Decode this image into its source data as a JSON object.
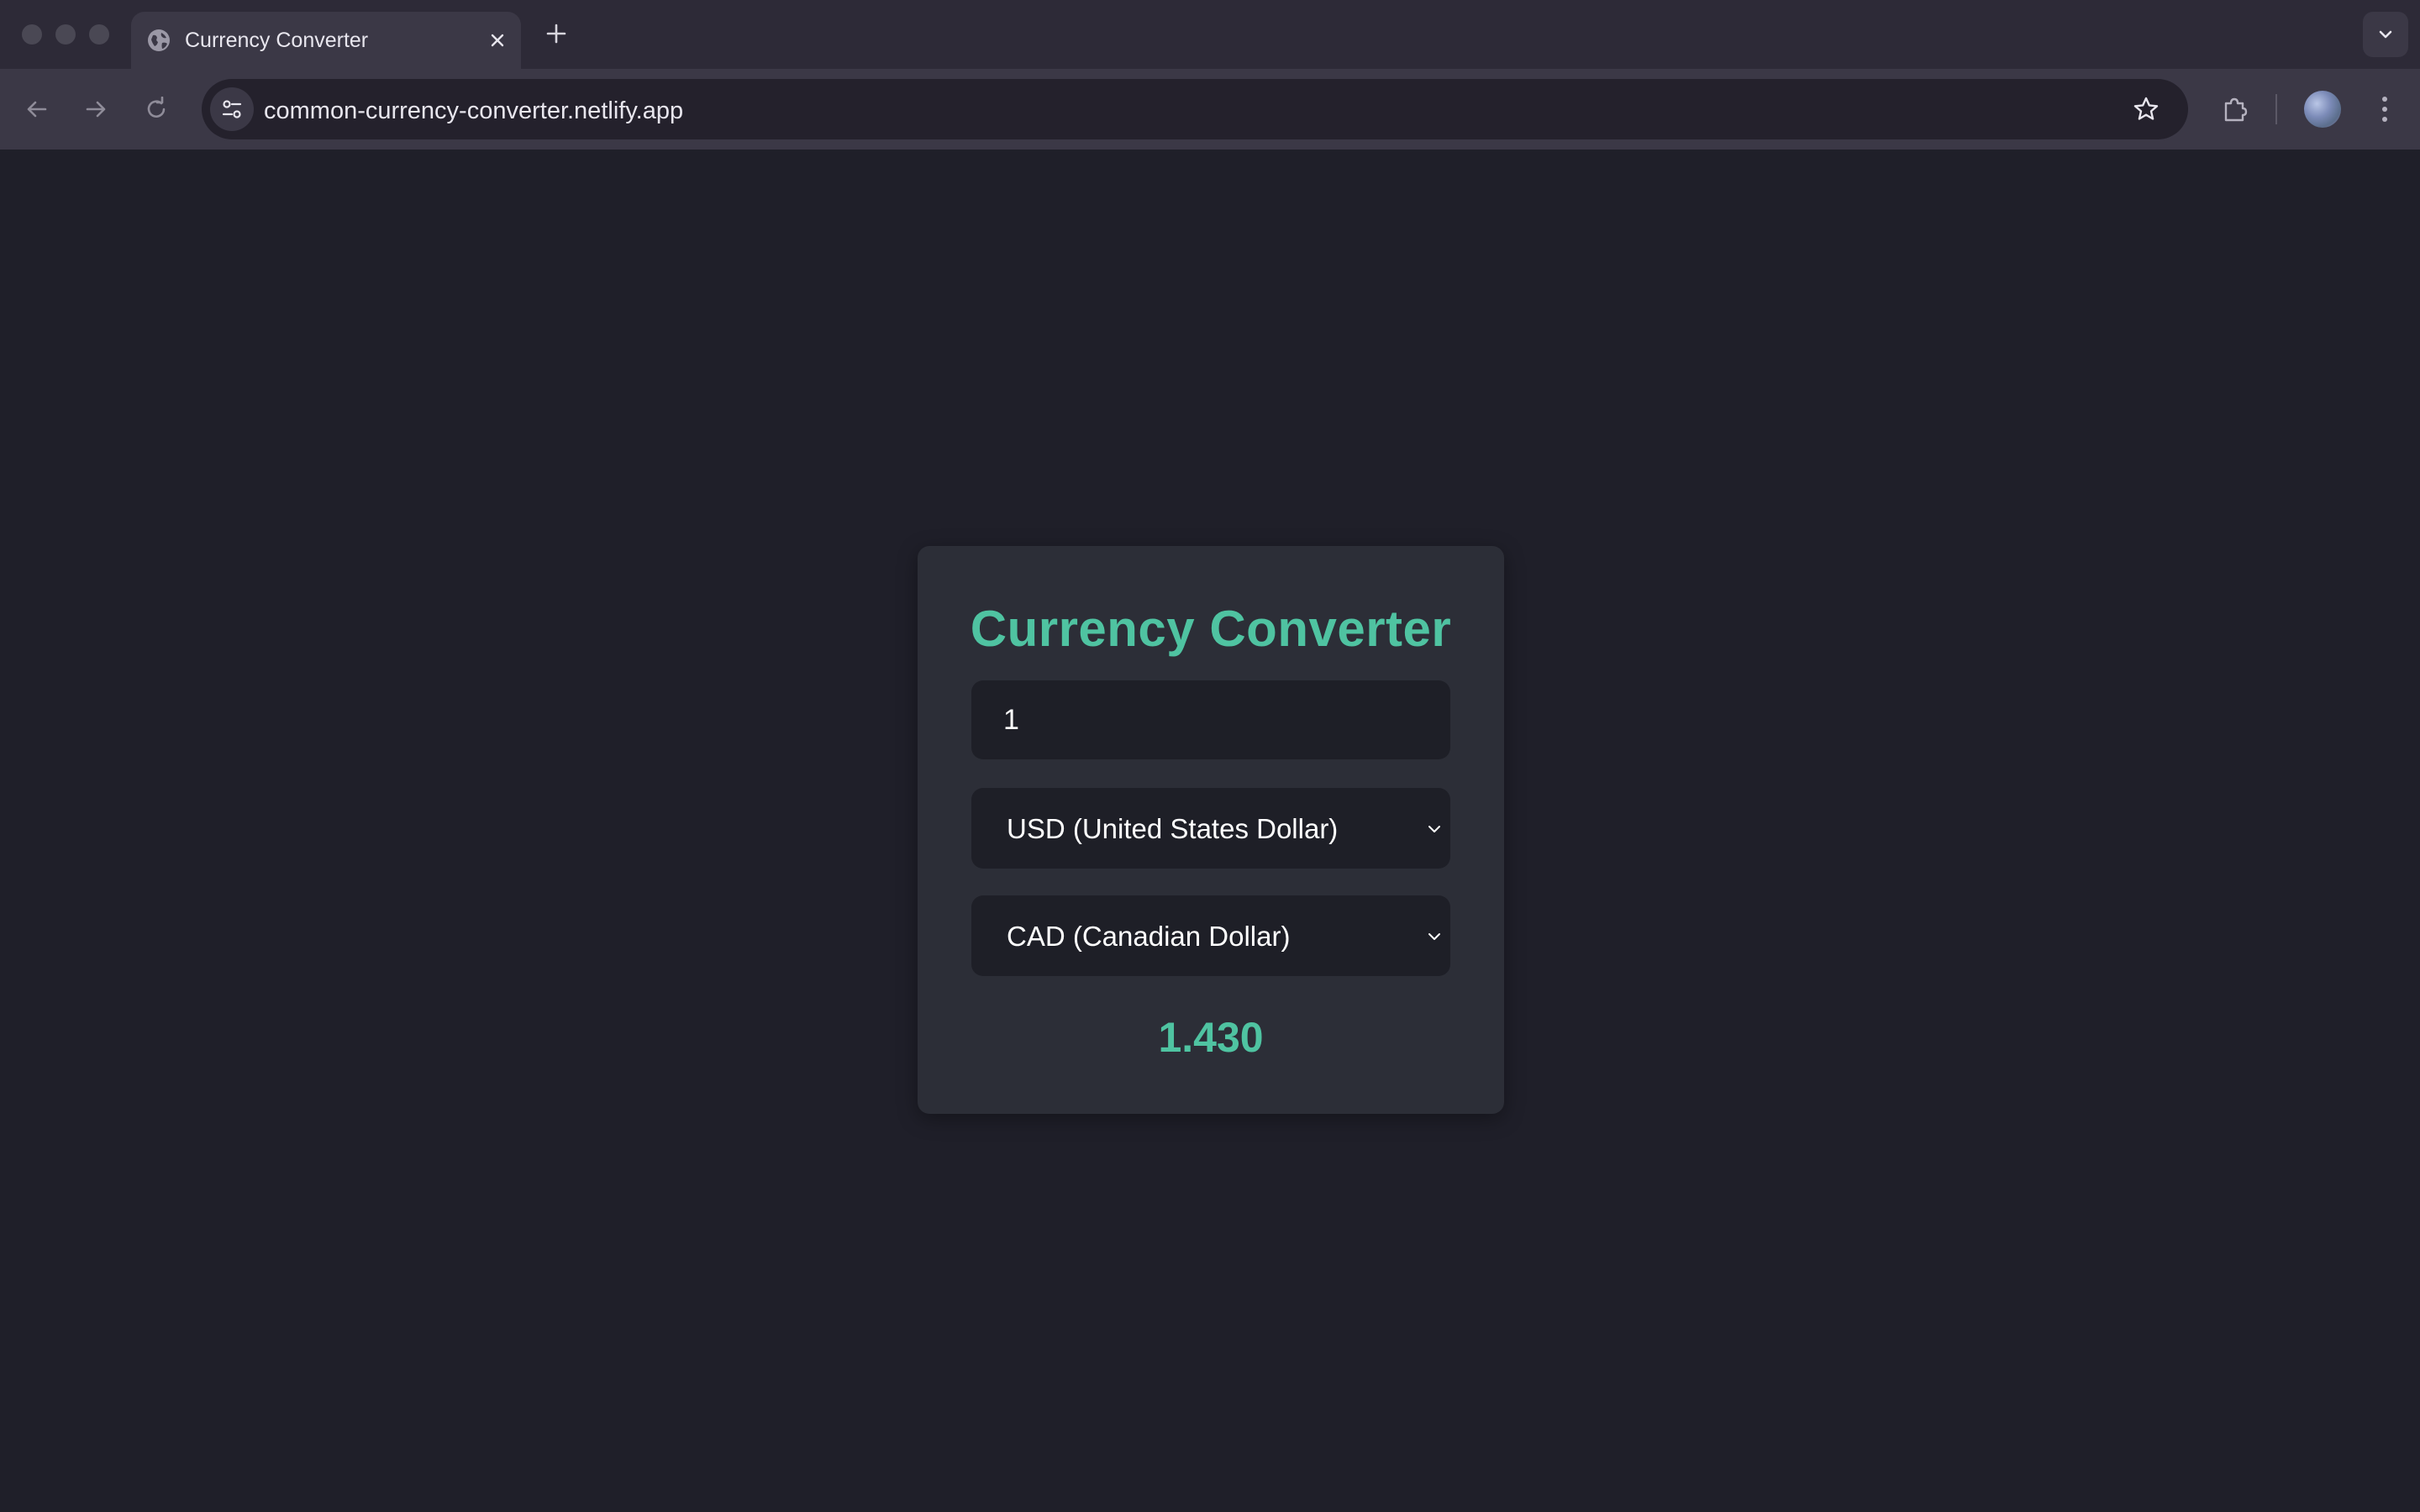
{
  "browser": {
    "tab": {
      "title": "Currency Converter",
      "favicon": "globe-icon"
    },
    "address_bar": {
      "url": "common-currency-converter.netlify.app"
    },
    "icons": {
      "back": "arrow-left-icon",
      "forward": "arrow-right-icon",
      "reload": "reload-icon",
      "site_info": "tune-icon",
      "bookmark": "star-icon",
      "extensions": "puzzle-icon",
      "menu": "kebab-menu-icon",
      "new_tab": "plus-icon",
      "tab_search": "chevron-down-icon"
    }
  },
  "converter": {
    "title": "Currency Converter",
    "amount": "1",
    "from_currency": "USD (United States Dollar)",
    "to_currency": "CAD (Canadian Dollar)",
    "result": "1.430"
  },
  "colors": {
    "accent": "#4fc3a1",
    "page_background": "#1f1f29",
    "card_background": "#2c2e37",
    "field_background": "#1e1f27"
  }
}
